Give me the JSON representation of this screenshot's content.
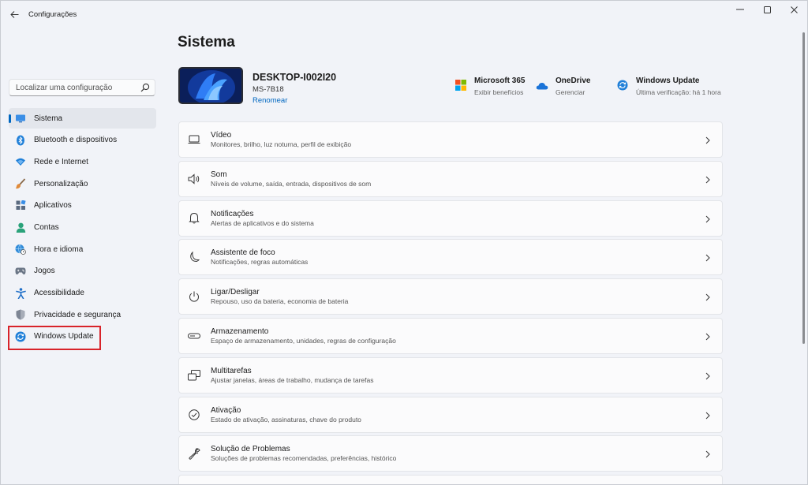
{
  "window": {
    "title": "Configurações"
  },
  "search": {
    "placeholder": "Localizar uma configuração"
  },
  "sidebar": {
    "items": [
      {
        "label": "Sistema",
        "icon": "monitor-icon",
        "selected": true
      },
      {
        "label": "Bluetooth e dispositivos",
        "icon": "bluetooth-icon"
      },
      {
        "label": "Rede e Internet",
        "icon": "wifi-icon"
      },
      {
        "label": "Personalização",
        "icon": "brush-icon"
      },
      {
        "label": "Aplicativos",
        "icon": "apps-icon"
      },
      {
        "label": "Contas",
        "icon": "account-icon"
      },
      {
        "label": "Hora e idioma",
        "icon": "globe-clock-icon"
      },
      {
        "label": "Jogos",
        "icon": "gamepad-icon"
      },
      {
        "label": "Acessibilidade",
        "icon": "accessibility-icon"
      },
      {
        "label": "Privacidade e segurança",
        "icon": "shield-icon"
      },
      {
        "label": "Windows Update",
        "icon": "windows-update-icon"
      }
    ]
  },
  "main": {
    "title": "Sistema",
    "device": {
      "name": "DESKTOP-I002I20",
      "model": "MS-7B18",
      "rename": "Renomear"
    },
    "quick": [
      {
        "title": "Microsoft 365",
        "sub": "Exibir benefícios",
        "icon": "microsoft-logo-icon"
      },
      {
        "title": "OneDrive",
        "sub": "Gerenciar",
        "icon": "onedrive-cloud-icon"
      },
      {
        "title": "Windows Update",
        "sub": "Última verificação: há 1 hora",
        "icon": "windows-update-icon"
      }
    ],
    "cards": [
      {
        "title": "Vídeo",
        "desc": "Monitores, brilho, luz noturna, perfil de exibição",
        "icon": "display-icon"
      },
      {
        "title": "Som",
        "desc": "Níveis de volume, saída, entrada, dispositivos de som",
        "icon": "speaker-icon"
      },
      {
        "title": "Notificações",
        "desc": "Alertas de aplicativos e do sistema",
        "icon": "bell-icon"
      },
      {
        "title": "Assistente de foco",
        "desc": "Notificações, regras automáticas",
        "icon": "moon-icon"
      },
      {
        "title": "Ligar/Desligar",
        "desc": "Repouso, uso da bateria, economia de bateria",
        "icon": "power-icon"
      },
      {
        "title": "Armazenamento",
        "desc": "Espaço de armazenamento, unidades, regras de configuração",
        "icon": "storage-icon"
      },
      {
        "title": "Multitarefas",
        "desc": "Ajustar janelas, áreas de trabalho, mudança de tarefas",
        "icon": "multitask-icon"
      },
      {
        "title": "Ativação",
        "desc": "Estado de ativação, assinaturas, chave do produto",
        "icon": "check-circle-icon"
      },
      {
        "title": "Solução de Problemas",
        "desc": "Soluções de problemas recomendadas, preferências, histórico",
        "icon": "wrench-icon"
      }
    ]
  },
  "colors": {
    "accent": "#0067c0",
    "highlight": "#d8232a"
  }
}
